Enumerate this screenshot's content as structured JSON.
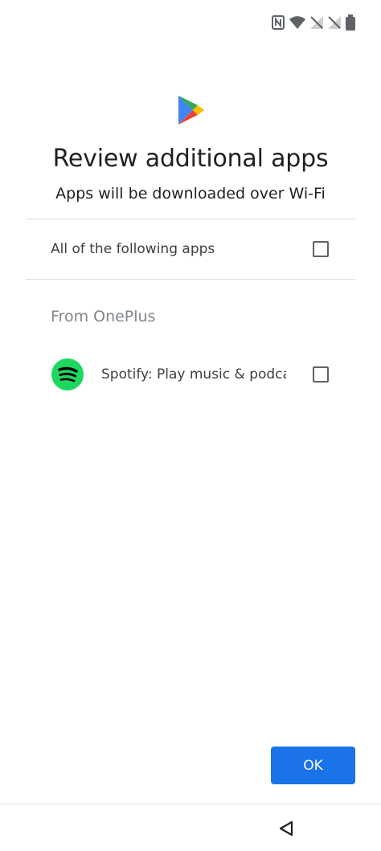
{
  "status_bar": {
    "icons": [
      "nfc-icon",
      "wifi-icon",
      "signal-off-icon",
      "signal-off-icon",
      "battery-icon"
    ]
  },
  "header": {
    "logo": "google-play-icon",
    "title": "Review additional apps",
    "subtitle": "Apps will be downloaded over Wi-Fi"
  },
  "select_all": {
    "label": "All of the following apps",
    "checked": false
  },
  "section": {
    "header": "From OnePlus",
    "apps": [
      {
        "name": "Spotify: Play music & podcasts",
        "icon": "spotify-icon",
        "checked": false
      }
    ]
  },
  "actions": {
    "ok_label": "OK"
  },
  "nav_bar": {
    "back": "back-icon"
  },
  "colors": {
    "accent": "#1a73e8",
    "spotify": "#1ed760"
  }
}
